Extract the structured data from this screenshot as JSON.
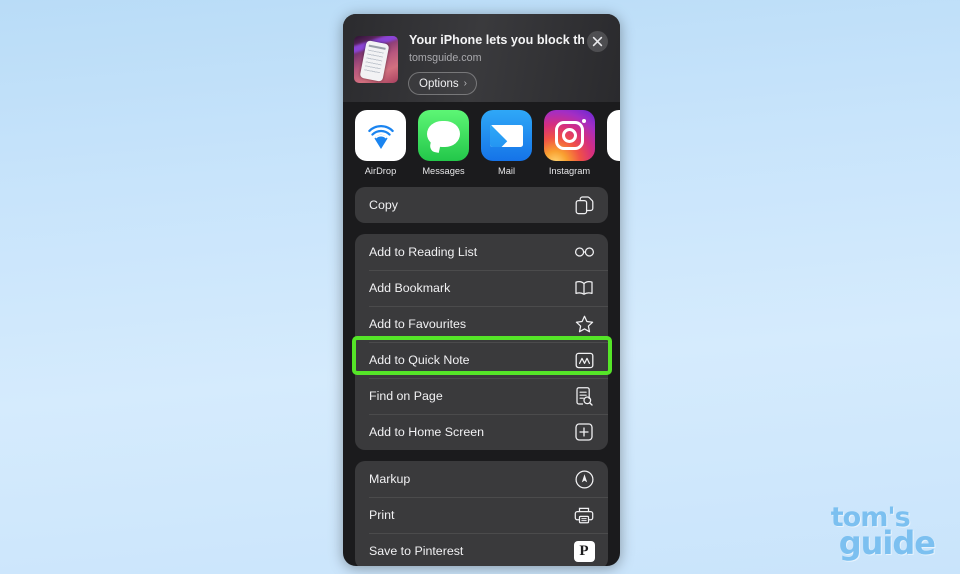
{
  "background": {
    "color_top": "#b9dcf7",
    "color_bottom": "#c9e4fb"
  },
  "share_sheet": {
    "header": {
      "title": "Your iPhone lets you block th...",
      "subtitle": "tomsguide.com",
      "thumbnail_name": "page-thumbnail",
      "options_label": "Options",
      "options_chevron": "›",
      "close_label": "close-icon"
    },
    "apps": [
      {
        "name": "AirDrop",
        "icon": "airdrop-icon"
      },
      {
        "name": "Messages",
        "icon": "messages-icon"
      },
      {
        "name": "Mail",
        "icon": "mail-icon"
      },
      {
        "name": "Instagram",
        "icon": "instagram-icon"
      },
      {
        "name": "",
        "icon": "facebook-icon"
      }
    ],
    "groups": [
      {
        "id": "group-copy",
        "rows": [
          {
            "id": "copy",
            "label": "Copy",
            "icon": "copy-icon"
          }
        ]
      },
      {
        "id": "group-browser-actions",
        "rows": [
          {
            "id": "add-to-reading-list",
            "label": "Add to Reading List",
            "icon": "glasses-icon"
          },
          {
            "id": "add-bookmark",
            "label": "Add Bookmark",
            "icon": "book-icon"
          },
          {
            "id": "add-to-favourites",
            "label": "Add to Favourites",
            "icon": "star-icon"
          },
          {
            "id": "add-to-quick-note",
            "label": "Add to Quick Note",
            "icon": "quick-note-icon",
            "highlighted": true
          },
          {
            "id": "find-on-page",
            "label": "Find on Page",
            "icon": "find-on-page-icon"
          },
          {
            "id": "add-to-home-screen",
            "label": "Add to Home Screen",
            "icon": "plus-square-icon"
          }
        ]
      },
      {
        "id": "group-tools",
        "rows": [
          {
            "id": "markup",
            "label": "Markup",
            "icon": "markup-icon"
          },
          {
            "id": "print",
            "label": "Print",
            "icon": "printer-icon"
          },
          {
            "id": "save-to-pinterest",
            "label": "Save to Pinterest",
            "icon": "pinterest-icon",
            "icon_text": "P"
          }
        ]
      }
    ],
    "highlight": {
      "color": "#55e528"
    }
  },
  "watermark": {
    "line1": "tom's",
    "line2": "guide",
    "color": "#7cc0f0"
  }
}
